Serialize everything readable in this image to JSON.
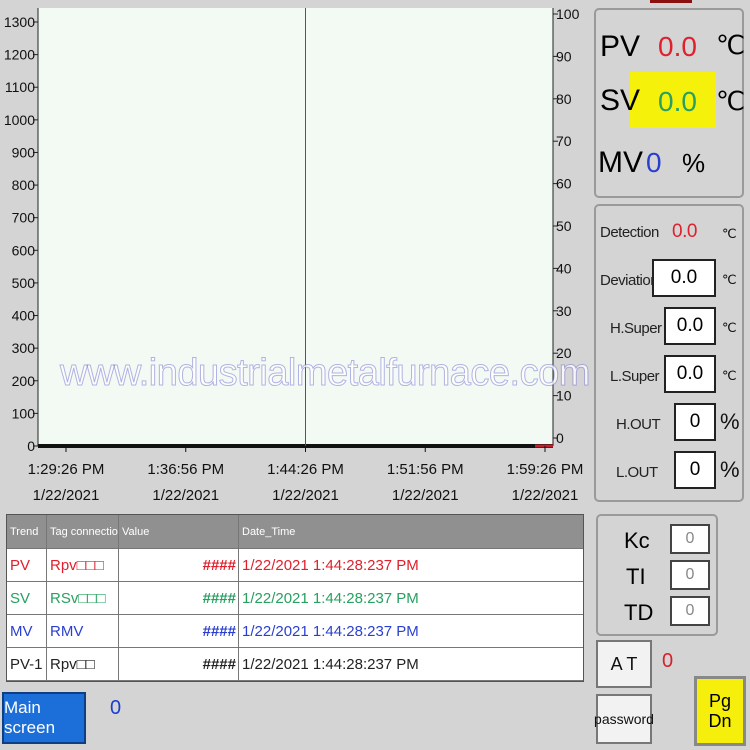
{
  "chart_data": {
    "type": "line",
    "y_left": {
      "ticks": [
        0,
        100,
        200,
        300,
        400,
        500,
        600,
        700,
        800,
        900,
        1000,
        1100,
        1200,
        1300
      ],
      "range": [
        0,
        1300
      ]
    },
    "y_right": {
      "ticks": [
        0,
        10,
        20,
        30,
        40,
        50,
        60,
        70,
        80,
        90,
        100
      ],
      "range": [
        0,
        100
      ]
    },
    "x_ticks": [
      {
        "time": "1:29:26 PM",
        "date": "1/22/2021"
      },
      {
        "time": "1:36:56 PM",
        "date": "1/22/2021"
      },
      {
        "time": "1:44:26 PM",
        "date": "1/22/2021"
      },
      {
        "time": "1:51:56 PM",
        "date": "1/22/2021"
      },
      {
        "time": "1:59:26 PM",
        "date": "1/22/2021"
      }
    ],
    "cursor_time": "1:44:26 PM",
    "series": [],
    "grid": false
  },
  "table": {
    "headers": [
      "Trend",
      "Tag connection",
      "Value",
      "Date_Time"
    ],
    "rows": [
      {
        "trend": "PV",
        "tag": "Rpv□□□",
        "value": "####",
        "date": "1/22/2021 1:44:28:237 PM",
        "color": "#e0202c"
      },
      {
        "trend": "SV",
        "tag": "RSv□□□",
        "value": "####",
        "date": "1/22/2021 1:44:28:237 PM",
        "color": "#27a060"
      },
      {
        "trend": "MV",
        "tag": "RMV",
        "value": "####",
        "date": "1/22/2021 1:44:28:237 PM",
        "color": "#2a3fd0"
      },
      {
        "trend": "PV-1",
        "tag": "Rpv□□",
        "value": "####",
        "date": "1/22/2021 1:44:28:237 PM",
        "color": "#222222"
      }
    ]
  },
  "main_panel": {
    "pv_label": "PV",
    "pv_value": "0.0",
    "pv_unit": "℃",
    "sv_label": "SV",
    "sv_value": "0.0",
    "sv_unit": "℃",
    "mv_label": "MV",
    "mv_value": "0",
    "mv_unit": "%"
  },
  "alarm_panel": {
    "detection_label": "Detection",
    "detection_value": "0.0",
    "detection_unit": "℃",
    "deviation_label": "Deviation",
    "deviation_value": "0.0",
    "deviation_unit": "℃",
    "hsuper_label": "H.Super",
    "hsuper_value": "0.0",
    "hsuper_unit": "℃",
    "lsuper_label": "L.Super",
    "lsuper_value": "0.0",
    "lsuper_unit": "℃",
    "hout_label": "H.OUT",
    "hout_value": "0",
    "hout_unit": "%",
    "lout_label": "L.OUT",
    "lout_value": "0",
    "lout_unit": "%"
  },
  "pid_panel": {
    "kc_label": "Kc",
    "kc_value": "0",
    "ti_label": "TI",
    "ti_value": "0",
    "td_label": "TD",
    "td_value": "0"
  },
  "buttons": {
    "main_screen": "Main screen",
    "main_value": "0",
    "at": "A T",
    "at_value": "0",
    "password": "password",
    "pgdn_line1": "Pg",
    "pgdn_line2": "Dn"
  },
  "watermark": "www.industrialmetalfurnace.com",
  "colors": {
    "pv": "#e0202c",
    "sv": "#27a060",
    "mv": "#2a3fd0",
    "sv_highlight": "#f6f10a",
    "main_screen_button": "#1c6fd8",
    "pgdn_button": "#f6ef0b"
  }
}
